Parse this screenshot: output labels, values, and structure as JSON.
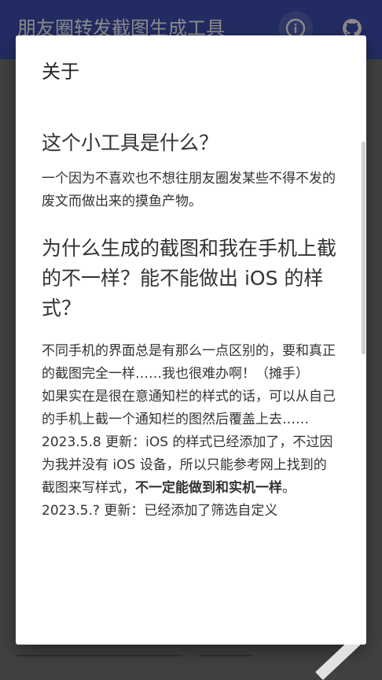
{
  "appbar": {
    "title": "朋友圈转发截图生成工具",
    "info_icon": "info-icon",
    "github_icon": "github-icon",
    "color": "#3f51b5"
  },
  "dialog": {
    "title": "关于",
    "sections": [
      {
        "question": "这个小工具是什么？",
        "answer": "一个因为不喜欢也不想往朋友圈发某些不得不发的废文而做出来的摸鱼产物。"
      },
      {
        "question": "为什么生成的截图和我在手机上截的不一样？能不能做出 iOS 的样式？",
        "answer_lines": [
          "不同手机的界面总是有那么一点区别的，要和真正的截图完全一样……我也很难办啊！（摊手）",
          "如果实在是很在意通知栏的样式的话，可以从自己的手机上截一个通知栏的图然后覆盖上去……"
        ],
        "update_prefix": "2023.5.8 更新：iOS 的样式已经添加了，不过因为我并没有 iOS 设备，所以只能参考网上找到的截图来写样式，",
        "update_emphasis": "不一定能做到和实机一样",
        "update_suffix": "。",
        "update_cutoff": "2023.5.? 更新：已经添加了筛选自定义"
      }
    ]
  }
}
